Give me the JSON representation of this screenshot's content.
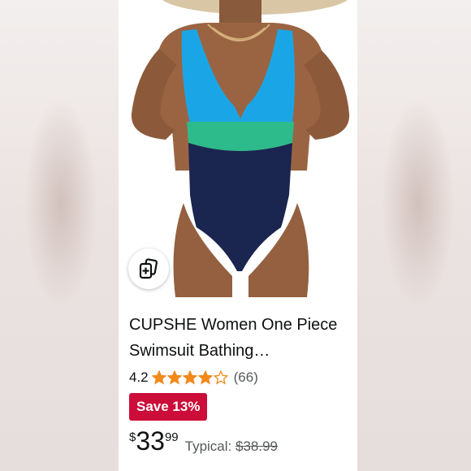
{
  "product": {
    "title": "CUPSHE Women One Piece Swimsuit Bathing…",
    "rating": "4.2",
    "rating_value": 4.2,
    "star_count": 5,
    "review_count": "(66)",
    "save_label": "Save 13%",
    "price_symbol": "$",
    "price_whole": "33",
    "price_fraction": "99",
    "typical_label": "Typical:",
    "typical_price": "$38.99"
  },
  "colors": {
    "star": "#f1891b",
    "save_badge": "#cc0c39",
    "swimsuit_top": "#1aa6e6",
    "swimsuit_band": "#2dbb8c",
    "swimsuit_bottom": "#1a2550"
  },
  "icons": {
    "similar_items": "similar-items-icon",
    "star": "star-icon"
  }
}
